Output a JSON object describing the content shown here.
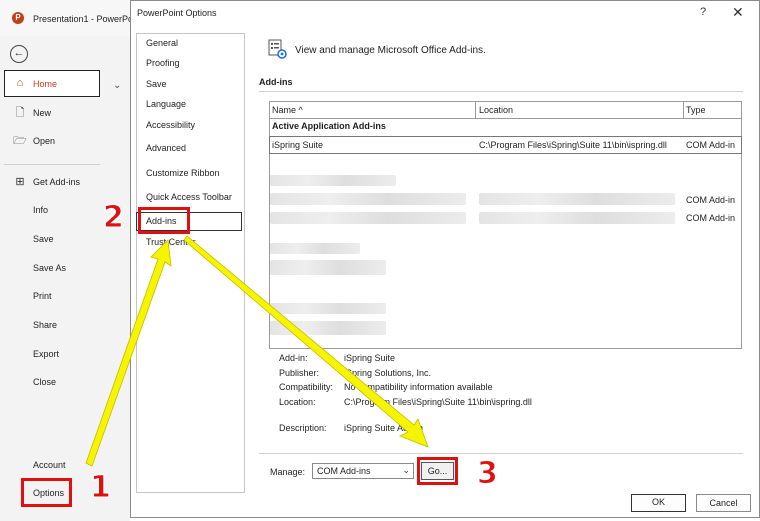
{
  "backstage": {
    "app_title": "Presentation1 - PowerPo",
    "logo_letter": "P",
    "back_icon": "arrow-left-icon",
    "items": [
      {
        "name": "home",
        "label": "Home",
        "icon": "home-icon"
      },
      {
        "name": "new",
        "label": "New",
        "icon": "new-file-icon"
      },
      {
        "name": "open",
        "label": "Open",
        "icon": "folder-open-icon"
      },
      {
        "name": "get-add-ins",
        "label": "Get Add-ins",
        "icon": "grid-icon"
      },
      {
        "name": "info",
        "label": "Info"
      },
      {
        "name": "save",
        "label": "Save"
      },
      {
        "name": "save-as",
        "label": "Save As"
      },
      {
        "name": "print",
        "label": "Print"
      },
      {
        "name": "share",
        "label": "Share"
      },
      {
        "name": "export",
        "label": "Export"
      },
      {
        "name": "close",
        "label": "Close"
      },
      {
        "name": "account",
        "label": "Account"
      },
      {
        "name": "options",
        "label": "Options"
      }
    ]
  },
  "dialog": {
    "title": "PowerPoint Options",
    "help": "?",
    "close": "✕",
    "nav": [
      "General",
      "Proofing",
      "Save",
      "Language",
      "Accessibility",
      "Advanced",
      "Customize Ribbon",
      "Quick Access Toolbar",
      "Add-ins",
      "Trust Center"
    ],
    "selected_nav": "Add-ins",
    "header_text": "View and manage Microsoft Office Add-ins.",
    "section_title": "Add-ins",
    "table": {
      "columns": [
        "Name ^",
        "Location",
        "Type"
      ],
      "group": "Active Application Add-ins",
      "selected_row": {
        "name": "iSpring Suite",
        "location": "C:\\Program Files\\iSpring\\Suite 11\\bin\\ispring.dll",
        "type": "COM Add-in"
      },
      "blurred_row_types": [
        "COM Add-in",
        "COM Add-in"
      ]
    },
    "details": {
      "addin_label": "Add-in:",
      "addin_value": "iSpring Suite",
      "publisher_label": "Publisher:",
      "publisher_value": "iSpring Solutions, Inc.",
      "compat_label": "Compatibility:",
      "compat_value": "No compatibility information available",
      "location_label": "Location:",
      "location_value": "C:\\Program Files\\iSpring\\Suite 11\\bin\\ispring.dll",
      "desc_label": "Description:",
      "desc_value": "iSpring Suite Add-in"
    },
    "manage_label": "Manage:",
    "manage_value": "COM Add-ins",
    "go_label": "Go...",
    "ok_label": "OK",
    "cancel_label": "Cancel"
  },
  "annotations": {
    "step1": "1",
    "step2": "2",
    "step3": "3",
    "highlight_color": "#e01010",
    "arrow_color": "#f5f500"
  }
}
